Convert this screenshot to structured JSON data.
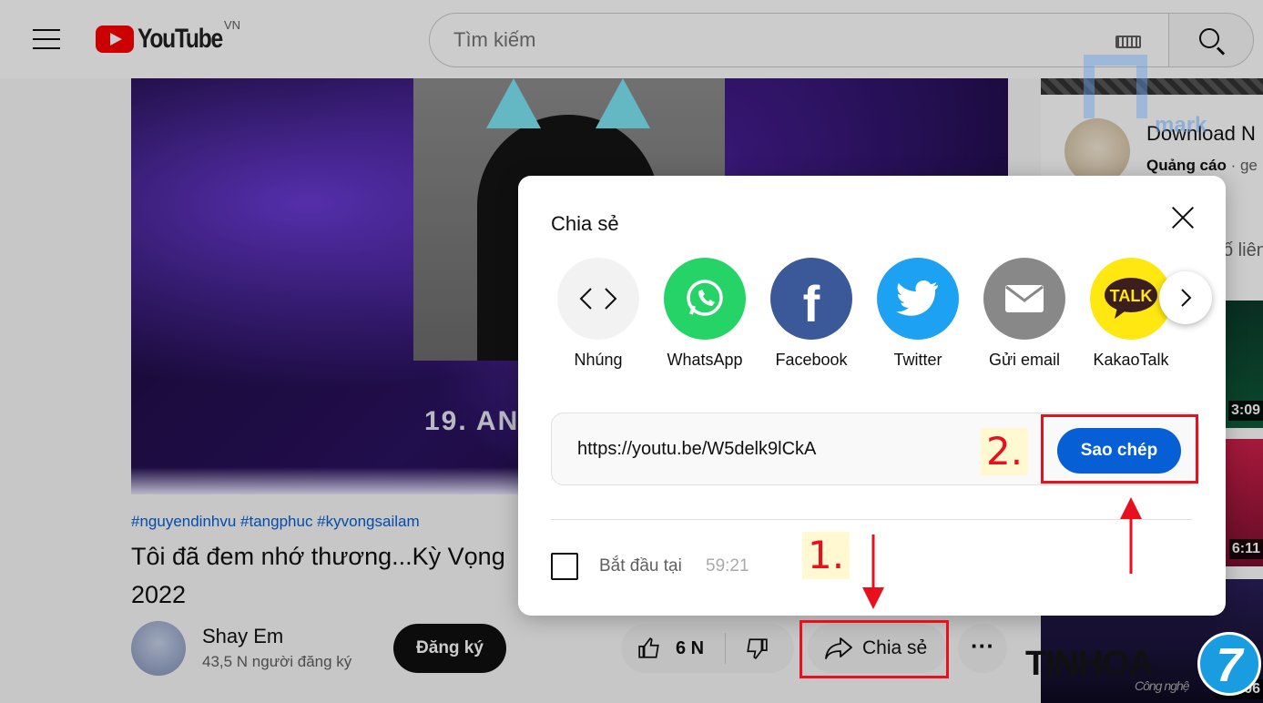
{
  "header": {
    "logo_text": "YouTube",
    "country_code": "VN",
    "search_placeholder": "Tìm kiếm"
  },
  "video": {
    "overlay_text": "19. AN",
    "tags": "#nguyendinhvu #tangphuc #kyvongsailam",
    "title_line1": "Tôi đã đem nhớ thương...Kỳ Vọng",
    "title_line2": "2022",
    "channel_name": "Shay Em",
    "subscribers": "43,5 N người đăng ký",
    "subscribe_label": "Đăng ký",
    "like_count": "6 N",
    "share_label": "Chia sẻ",
    "more_label": "···"
  },
  "sidebar": {
    "ad_title": "Download N",
    "ad_tag": "Quảng cáo",
    "ad_source": "· ge",
    "related_text": "ố liên",
    "durations": [
      "3:09",
      "6:11",
      "2:..:06"
    ]
  },
  "share_dialog": {
    "title": "Chia sẻ",
    "options": [
      {
        "label": "Nhúng",
        "icon": "embed-code-icon",
        "color": "#f2f2f2"
      },
      {
        "label": "WhatsApp",
        "icon": "whatsapp-icon",
        "color": "#25d366"
      },
      {
        "label": "Facebook",
        "icon": "facebook-icon",
        "color": "#3b5998"
      },
      {
        "label": "Twitter",
        "icon": "twitter-icon",
        "color": "#1da1f2"
      },
      {
        "label": "Gửi email",
        "icon": "email-icon",
        "color": "#888888"
      },
      {
        "label": "KakaoTalk",
        "icon": "kakaotalk-icon",
        "color": "#ffe812"
      }
    ],
    "url": "https://youtu.be/W5delk9lCkA",
    "copy_label": "Sao chép",
    "start_at_label": "Bắt đầu tại",
    "start_at_time": "59:21"
  },
  "annotations": {
    "step1": "1.",
    "step2": "2.",
    "color": "#e8101d"
  },
  "watermark": {
    "brand": "TINHOA",
    "tagline": "Công nghệ",
    "badge": "7",
    "tmark": "mark"
  }
}
